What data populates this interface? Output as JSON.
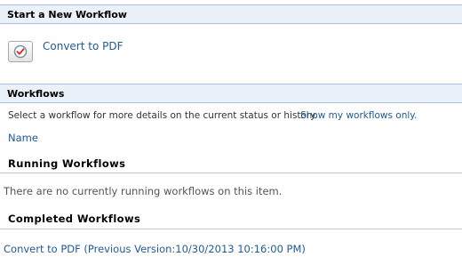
{
  "start_section": {
    "title": "Start a New Workflow",
    "workflow_link": "Convert to PDF"
  },
  "workflows_section": {
    "title": "Workflows",
    "instruction": "Select a workflow for more details on the current status or history.",
    "show_mine_link": "Show my workflows only.",
    "name_column": "Name",
    "running": {
      "title": "Running Workflows",
      "empty_message": "There are no currently running workflows on this item."
    },
    "completed": {
      "title": "Completed Workflows",
      "items": [
        "Convert to PDF (Previous Version:10/30/2013 10:16:00 PM)"
      ]
    }
  },
  "colors": {
    "link": "#1f5a99",
    "header_bg": "#eaf1f9",
    "header_border": "#aac5e2"
  },
  "icons": {
    "workflow": "checkmark-circle-icon"
  }
}
